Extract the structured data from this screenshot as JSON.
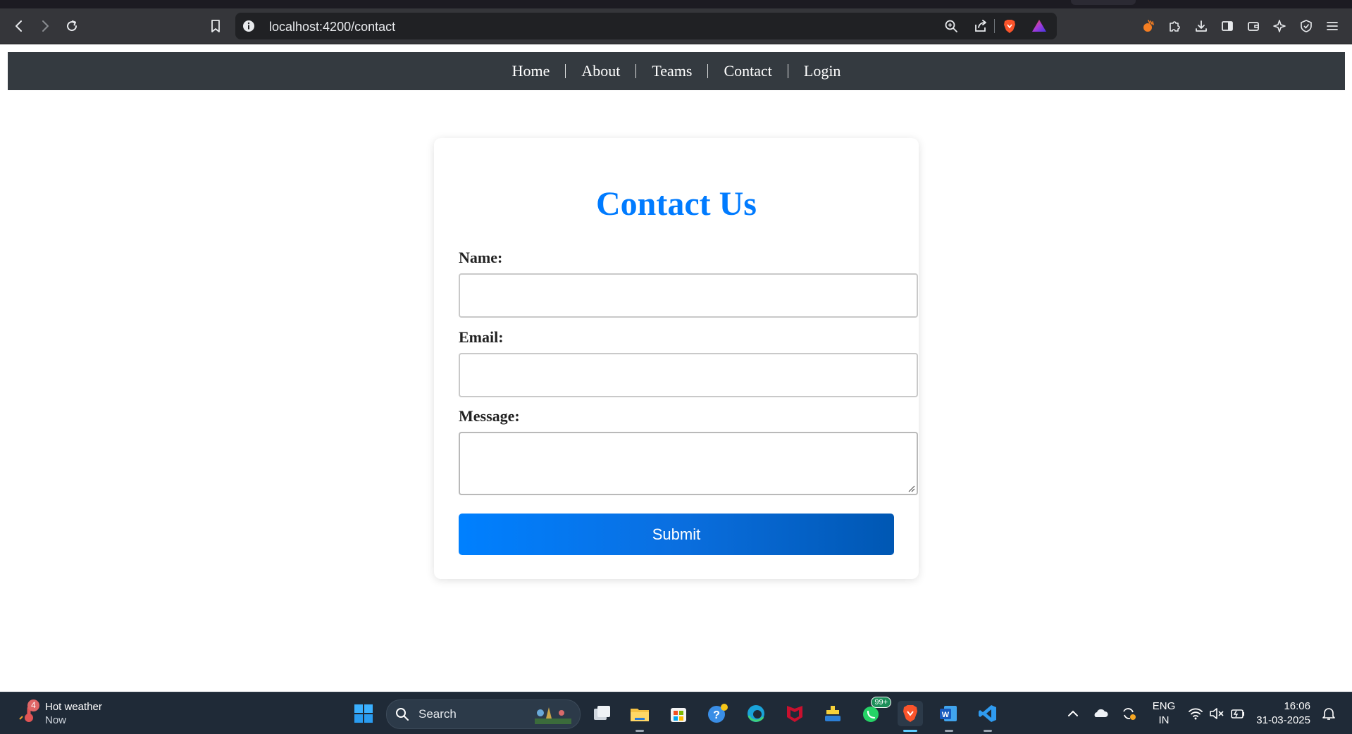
{
  "browser": {
    "url": "localhost:4200/contact",
    "icons": {
      "back": "back-arrow-icon",
      "forward": "forward-arrow-icon",
      "reload": "reload-icon",
      "bookmark": "bookmark-icon",
      "site_info": "info-icon",
      "zoom": "zoom-icon",
      "share": "share-icon",
      "brave_shields": "brave-lion-icon",
      "rewards": "brave-rewards-icon",
      "leo": "brave-leo-icon",
      "extensions": "puzzle-piece-icon",
      "downloads": "download-icon",
      "sidebar": "sidebar-icon",
      "wallet": "wallet-icon",
      "ai": "sparkle-icon",
      "vpn": "shield-icon",
      "menu": "hamburger-menu-icon"
    }
  },
  "nav": {
    "items": [
      {
        "label": "Home"
      },
      {
        "label": "About"
      },
      {
        "label": "Teams"
      },
      {
        "label": "Contact"
      },
      {
        "label": "Login"
      }
    ]
  },
  "form": {
    "title": "Contact Us",
    "name_label": "Name:",
    "name_value": "",
    "email_label": "Email:",
    "email_value": "",
    "message_label": "Message:",
    "message_value": "",
    "submit_label": "Submit"
  },
  "taskbar": {
    "weather_badge": "4",
    "weather_title": "Hot weather",
    "weather_time": "Now",
    "search_label": "Search",
    "whatsapp_badge": "99+",
    "language_top": "ENG",
    "language_bottom": "IN",
    "time": "16:06",
    "date": "31-03-2025"
  },
  "colors": {
    "nav_bg": "#343a40",
    "accent": "#007bff",
    "submit_start": "#0080ff",
    "submit_end": "#0057b3",
    "taskbar_bg": "#1f2a37"
  }
}
